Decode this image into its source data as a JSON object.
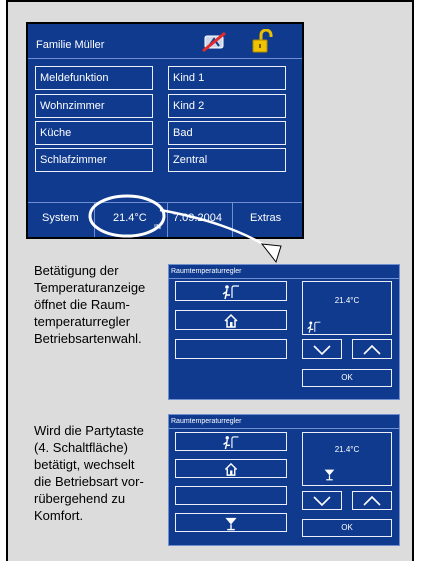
{
  "main_panel": {
    "title": "Familie Müller",
    "left_buttons": [
      "Meldefunktion",
      "Wohnzimmer",
      "Küche",
      "Schlafzimmer"
    ],
    "right_buttons": [
      "Kind 1",
      "Kind 2",
      "Bad",
      "Zentral"
    ],
    "footer": {
      "system": "System",
      "temperature": "21.4°C",
      "date": "7.09.2004",
      "extras": "Extras",
      "small_label": "IN"
    },
    "icons": [
      "signal-off-icon",
      "unlocked-padlock-icon"
    ]
  },
  "caption_1": {
    "lines": [
      "Betätigung der",
      "Temperaturanzeige",
      "öffnet die Raum-",
      "temperaturregler",
      "Betriebsartenwahl."
    ]
  },
  "caption_2": {
    "lines": [
      "Wird die Partytaste",
      "(4. Schaltfläche)",
      "betätigt, wechselt",
      "die Betriebsart vor-",
      "rübergehend zu",
      "Komfort."
    ]
  },
  "dialog_1": {
    "title": "Raumtemperaturregler",
    "temperature": "21.4°C",
    "ok": "OK",
    "mode_buttons": [
      "comfort-person-icon",
      "house-icon",
      "moon-icon"
    ]
  },
  "dialog_2": {
    "title": "Raumtemperaturregler",
    "temperature": "21.4°C",
    "ok": "OK",
    "mode_buttons": [
      "comfort-person-icon",
      "house-icon",
      "moon-icon",
      "cocktail-glass-icon"
    ]
  },
  "colors": {
    "panel_blue": "#0f3a8e",
    "button_border": "#e9eef8",
    "background": "#dcdcdc"
  }
}
